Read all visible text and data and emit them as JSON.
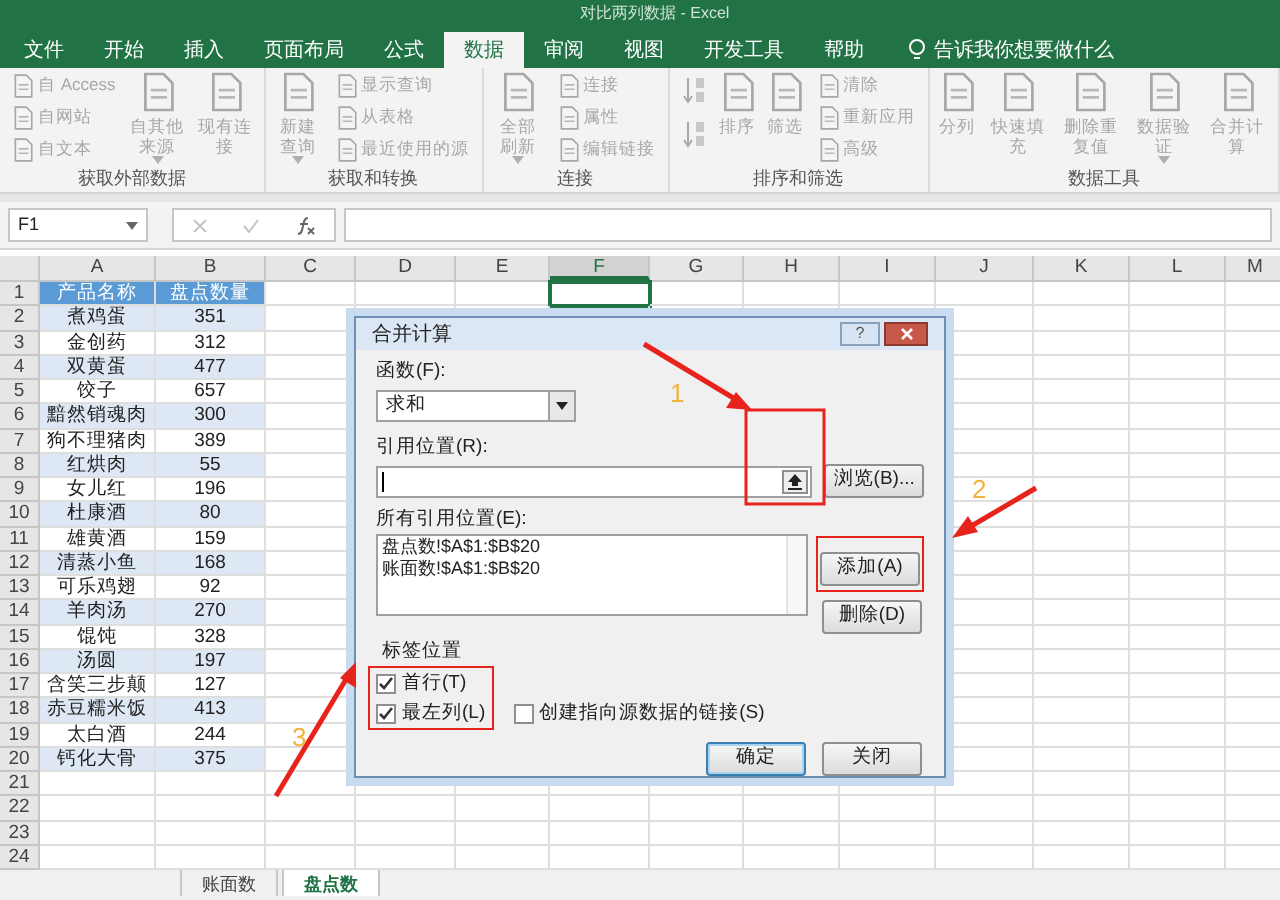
{
  "title_bar": {
    "title": "对比两列数据 - Excel"
  },
  "ribbon_tabs": [
    {
      "label": "文件",
      "selected": false
    },
    {
      "label": "开始",
      "selected": false
    },
    {
      "label": "插入",
      "selected": false
    },
    {
      "label": "页面布局",
      "selected": false
    },
    {
      "label": "公式",
      "selected": false
    },
    {
      "label": "数据",
      "selected": true
    },
    {
      "label": "审阅",
      "selected": false
    },
    {
      "label": "视图",
      "selected": false
    },
    {
      "label": "开发工具",
      "selected": false
    },
    {
      "label": "帮助",
      "selected": false
    }
  ],
  "tell_me": "告诉我你想要做什么",
  "ribbon_groups": [
    {
      "label": "获取外部数据",
      "columns": [
        {
          "kind": "stack",
          "items": [
            "自 Access",
            "自网站",
            "自文本"
          ]
        },
        {
          "kind": "large",
          "label": "自其他来源",
          "dropdown": true
        },
        {
          "kind": "large",
          "label": "现有连接",
          "dropdown": false
        }
      ]
    },
    {
      "label": "获取和转换",
      "columns": [
        {
          "kind": "large",
          "label": "新建查询",
          "dropdown": true
        },
        {
          "kind": "stack",
          "items": [
            "显示查询",
            "从表格",
            "最近使用的源"
          ]
        }
      ]
    },
    {
      "label": "连接",
      "columns": [
        {
          "kind": "large",
          "label": "全部刷新",
          "dropdown": true
        },
        {
          "kind": "stack",
          "items": [
            "连接",
            "属性",
            "编辑链接"
          ]
        }
      ]
    },
    {
      "label": "排序和筛选",
      "columns": [
        {
          "kind": "sort"
        },
        {
          "kind": "large",
          "label": "排序",
          "dropdown": false
        },
        {
          "kind": "large",
          "label": "筛选",
          "dropdown": false
        },
        {
          "kind": "stack",
          "items": [
            "清除",
            "重新应用",
            "高级"
          ]
        }
      ]
    },
    {
      "label": "数据工具",
      "columns": [
        {
          "kind": "large",
          "label": "分列",
          "dropdown": false
        },
        {
          "kind": "large",
          "label": "快速填充",
          "dropdown": false
        },
        {
          "kind": "large",
          "label": "删除重复值",
          "dropdown": false
        },
        {
          "kind": "large",
          "label": "数据验证",
          "dropdown": true
        },
        {
          "kind": "large",
          "label": "合并计算",
          "dropdown": false
        }
      ]
    }
  ],
  "name_box": "F1",
  "columns": [
    {
      "label": "A",
      "selected": false
    },
    {
      "label": "B",
      "selected": false
    },
    {
      "label": "C",
      "selected": false
    },
    {
      "label": "D",
      "selected": false
    },
    {
      "label": "E",
      "selected": false
    },
    {
      "label": "F",
      "selected": true
    },
    {
      "label": "G",
      "selected": false
    },
    {
      "label": "H",
      "selected": false
    },
    {
      "label": "I",
      "selected": false
    },
    {
      "label": "J",
      "selected": false
    },
    {
      "label": "K",
      "selected": false
    },
    {
      "label": "L",
      "selected": false
    },
    {
      "label": "M",
      "selected": false
    }
  ],
  "row_numbers": [
    "1",
    "2",
    "3",
    "4",
    "5",
    "6",
    "7",
    "8",
    "9",
    "10",
    "11",
    "12",
    "13",
    "14",
    "15",
    "16",
    "17",
    "18",
    "19",
    "20",
    "21",
    "22",
    "23",
    "24"
  ],
  "table": {
    "header": [
      "产品名称",
      "盘点数量"
    ],
    "rows": [
      [
        "煮鸡蛋",
        "351"
      ],
      [
        "金创药",
        "312"
      ],
      [
        "双黄蛋",
        "477"
      ],
      [
        "饺子",
        "657"
      ],
      [
        "黯然销魂肉",
        "300"
      ],
      [
        "狗不理猪肉",
        "389"
      ],
      [
        "红烘肉",
        "55"
      ],
      [
        "女儿红",
        "196"
      ],
      [
        "杜康酒",
        "80"
      ],
      [
        "雄黄酒",
        "159"
      ],
      [
        "清蒸小鱼",
        "168"
      ],
      [
        "可乐鸡翅",
        "92"
      ],
      [
        "羊肉汤",
        "270"
      ],
      [
        "馄饨",
        "328"
      ],
      [
        "汤圆",
        "197"
      ],
      [
        "含笑三步颠",
        "127"
      ],
      [
        "赤豆糯米饭",
        "413"
      ],
      [
        "太白酒",
        "244"
      ],
      [
        "钙化大骨",
        "375"
      ]
    ]
  },
  "sheet_tabs": [
    {
      "label": "账面数",
      "selected": false
    },
    {
      "label": "盘点数",
      "selected": true
    }
  ],
  "dialog": {
    "title": "合并计算",
    "help": "?",
    "function_label": "函数(F):",
    "function_value": "求和",
    "reference_label": "引用位置(R):",
    "browse_button": "浏览(B)...",
    "all_references_label": "所有引用位置(E):",
    "references": [
      "盘点数!$A$1:$B$20",
      "账面数!$A$1:$B$20"
    ],
    "add_button": "添加(A)",
    "delete_button": "删除(D)",
    "labels_group": "标签位置",
    "options": [
      {
        "label": "首行(T)",
        "checked": true
      },
      {
        "label": "最左列(L)",
        "checked": true
      },
      {
        "label": "创建指向源数据的链接(S)",
        "checked": false
      }
    ],
    "ok_button": "确定",
    "close_button": "关闭"
  },
  "annotations": [
    {
      "label": "1"
    },
    {
      "label": "2"
    },
    {
      "label": "3"
    }
  ]
}
